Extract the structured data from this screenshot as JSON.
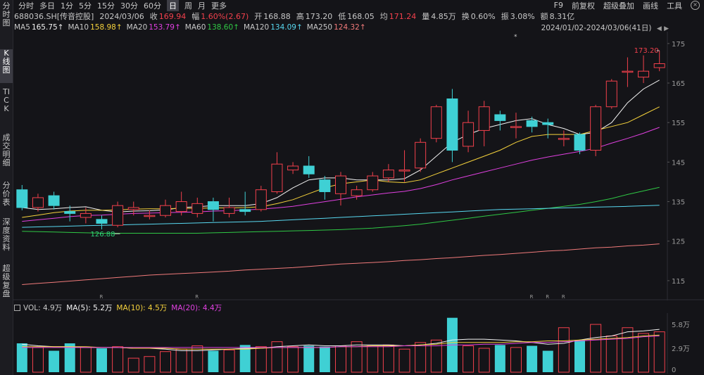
{
  "sidebar": {
    "tabs": [
      {
        "label": "分时图",
        "active": false
      },
      {
        "label": "K线图",
        "active": true
      },
      {
        "label": "TICK",
        "active": false
      },
      {
        "label": "成交明细",
        "active": false
      },
      {
        "label": "分价表",
        "active": false
      },
      {
        "label": "深度资料",
        "active": false
      },
      {
        "label": "超级复盘",
        "active": false
      }
    ]
  },
  "toolbar": {
    "periods": [
      {
        "label": "分时",
        "active": false
      },
      {
        "label": "多日",
        "active": false
      },
      {
        "label": "1分",
        "active": false
      },
      {
        "label": "5分",
        "active": false
      },
      {
        "label": "15分",
        "active": false
      },
      {
        "label": "30分",
        "active": false
      },
      {
        "label": "60分",
        "active": false
      },
      {
        "label": "日",
        "active": true
      },
      {
        "label": "周",
        "active": false
      },
      {
        "label": "月",
        "active": false
      },
      {
        "label": "更多",
        "active": false
      }
    ],
    "right_links": [
      "F9",
      "前复权",
      "超级叠加",
      "画线",
      "工具"
    ]
  },
  "quote": {
    "code_name": "688036.SH[传音控股]",
    "date": "2024/03/06",
    "close_label": "收",
    "close": "169.94",
    "change_label": "幅",
    "change": "1.60%(2.67)",
    "open_label": "开",
    "open": "168.88",
    "high_label": "高",
    "high": "173.20",
    "low_label": "低",
    "low": "168.05",
    "avg_label": "均",
    "avg": "171.24",
    "volume_label": "量",
    "volume": "4.85万",
    "turnover_label": "换",
    "turnover": "0.60%",
    "amplitude_label": "振",
    "amplitude": "3.08%",
    "amount_label": "额",
    "amount": "8.31亿"
  },
  "ma_legend": [
    {
      "label": "MA5",
      "value": "165.75↑",
      "color": "#f2f2f2"
    },
    {
      "label": "MA10",
      "value": "158.98↑",
      "color": "#f5d23c"
    },
    {
      "label": "MA20",
      "value": "153.79↑",
      "color": "#e040e0"
    },
    {
      "label": "MA60",
      "value": "138.60↑",
      "color": "#2fc845"
    },
    {
      "label": "MA120",
      "value": "134.09↑",
      "color": "#58d8f0"
    },
    {
      "label": "MA250",
      "value": "124.32↑",
      "color": "#f07a7a"
    }
  ],
  "date_range": "2024/01/02-2024/03/06(41日)",
  "vol_legend": {
    "vol": "VOL: 4.9万",
    "ma5": "MA(5): 5.2万",
    "ma10": "MA(10): 4.5万",
    "ma20": "MA(20): 4.4万"
  },
  "price_axis_ticks": [
    "175",
    "165",
    "155",
    "145",
    "135",
    "125",
    "115"
  ],
  "vol_axis_ticks": [
    "5.8万",
    "2.9万",
    "0"
  ],
  "annotations": {
    "high_label": "173.20",
    "low_label": "126.88",
    "restoration_marker": "R",
    "star_marker": "*"
  },
  "colors": {
    "up": "#f2404c",
    "down": "#3fd0d4",
    "background": "#141418"
  },
  "chart_data": {
    "type": "candlestick",
    "ylim": [
      110,
      178
    ],
    "candles": [
      {
        "o": 138.0,
        "c": 133.5,
        "h": 139.2,
        "l": 132.8,
        "v": 3.5
      },
      {
        "o": 133.5,
        "c": 136.0,
        "h": 137.0,
        "l": 132.5,
        "v": 3.0
      },
      {
        "o": 136.5,
        "c": 134.0,
        "h": 137.5,
        "l": 133.0,
        "v": 2.6
      },
      {
        "o": 132.5,
        "c": 132.0,
        "h": 134.0,
        "l": 130.0,
        "v": 3.5
      },
      {
        "o": 131.0,
        "c": 132.0,
        "h": 133.5,
        "l": 129.5,
        "v": 3.0
      },
      {
        "o": 130.5,
        "c": 129.5,
        "h": 131.5,
        "l": 128.0,
        "v": 2.9
      },
      {
        "o": 129.0,
        "c": 134.0,
        "h": 135.0,
        "l": 128.5,
        "v": 3.1
      },
      {
        "o": 133.0,
        "c": 133.5,
        "h": 135.0,
        "l": 131.5,
        "v": 1.7
      },
      {
        "o": 131.5,
        "c": 131.5,
        "h": 132.8,
        "l": 130.5,
        "v": 1.9
      },
      {
        "o": 131.5,
        "c": 134.0,
        "h": 135.5,
        "l": 131.0,
        "v": 2.5
      },
      {
        "o": 132.5,
        "c": 135.0,
        "h": 137.5,
        "l": 131.5,
        "v": 2.8
      },
      {
        "o": 132.0,
        "c": 134.5,
        "h": 136.0,
        "l": 131.0,
        "v": 3.2
      },
      {
        "o": 135.0,
        "c": 133.0,
        "h": 136.0,
        "l": 130.0,
        "v": 2.6
      },
      {
        "o": 132.0,
        "c": 133.5,
        "h": 136.0,
        "l": 131.0,
        "v": 2.7
      },
      {
        "o": 133.0,
        "c": 132.5,
        "h": 137.5,
        "l": 131.5,
        "v": 3.3
      },
      {
        "o": 133.0,
        "c": 138.0,
        "h": 139.0,
        "l": 132.5,
        "v": 3.1
      },
      {
        "o": 137.5,
        "c": 144.5,
        "h": 147.5,
        "l": 137.0,
        "v": 3.7
      },
      {
        "o": 143.0,
        "c": 144.0,
        "h": 145.0,
        "l": 142.0,
        "v": 3.1
      },
      {
        "o": 144.0,
        "c": 142.0,
        "h": 146.5,
        "l": 141.0,
        "v": 3.2
      },
      {
        "o": 140.5,
        "c": 137.5,
        "h": 141.5,
        "l": 135.5,
        "v": 3.1
      },
      {
        "o": 137.0,
        "c": 141.5,
        "h": 142.5,
        "l": 134.0,
        "v": 3.2
      },
      {
        "o": 136.5,
        "c": 138.0,
        "h": 139.0,
        "l": 135.5,
        "v": 3.7
      },
      {
        "o": 138.0,
        "c": 141.5,
        "h": 142.5,
        "l": 137.5,
        "v": 3.2
      },
      {
        "o": 141.0,
        "c": 143.0,
        "h": 144.5,
        "l": 140.0,
        "v": 3.3
      },
      {
        "o": 143.0,
        "c": 143.0,
        "h": 148.0,
        "l": 140.0,
        "v": 2.8
      },
      {
        "o": 143.5,
        "c": 150.0,
        "h": 151.0,
        "l": 142.5,
        "v": 3.6
      },
      {
        "o": 151.0,
        "c": 159.0,
        "h": 159.5,
        "l": 150.0,
        "v": 3.9
      },
      {
        "o": 161.0,
        "c": 148.0,
        "h": 163.5,
        "l": 145.0,
        "v": 6.6
      },
      {
        "o": 149.0,
        "c": 155.0,
        "h": 158.0,
        "l": 147.5,
        "v": 3.2
      },
      {
        "o": 153.0,
        "c": 159.0,
        "h": 160.5,
        "l": 149.0,
        "v": 2.9
      },
      {
        "o": 157.0,
        "c": 155.5,
        "h": 158.0,
        "l": 153.0,
        "v": 3.3
      },
      {
        "o": 154.0,
        "c": 154.0,
        "h": 157.5,
        "l": 151.0,
        "v": 3.0
      },
      {
        "o": 155.5,
        "c": 154.0,
        "h": 156.5,
        "l": 152.5,
        "v": 3.2
      },
      {
        "o": 155.0,
        "c": 154.5,
        "h": 156.0,
        "l": 151.0,
        "v": 2.6
      },
      {
        "o": 151.0,
        "c": 151.0,
        "h": 153.0,
        "l": 149.0,
        "v": 5.4
      },
      {
        "o": 152.0,
        "c": 148.0,
        "h": 152.5,
        "l": 147.0,
        "v": 3.9
      },
      {
        "o": 148.0,
        "c": 159.0,
        "h": 159.5,
        "l": 146.5,
        "v": 5.8
      },
      {
        "o": 159.0,
        "c": 165.5,
        "h": 166.0,
        "l": 158.5,
        "v": 4.4
      },
      {
        "o": 168.0,
        "c": 168.0,
        "h": 171.5,
        "l": 164.0,
        "v": 5.4
      },
      {
        "o": 166.5,
        "c": 168.0,
        "h": 172.0,
        "l": 165.0,
        "v": 4.7
      },
      {
        "o": 168.9,
        "c": 169.9,
        "h": 173.2,
        "l": 168.0,
        "v": 4.9
      }
    ],
    "moving_averages": [
      {
        "name": "MA5",
        "color": "#f2f2f2",
        "values": [
          133.5,
          133.0,
          133.2,
          133.5,
          133.7,
          132.8,
          132.4,
          132.6,
          132.7,
          132.9,
          133.5,
          133.7,
          134.0,
          134.0,
          134.0,
          134.5,
          136.0,
          138.5,
          140.5,
          141.0,
          141.0,
          140.5,
          140.5,
          140.5,
          140.8,
          143.0,
          146.5,
          150.0,
          152.0,
          153.5,
          154.5,
          155.5,
          156.0,
          154.5,
          153.5,
          152.0,
          152.5,
          155.0,
          160.0,
          163.5,
          165.75
        ]
      },
      {
        "name": "MA10",
        "color": "#f5d23c",
        "values": [
          131.0,
          131.6,
          132.2,
          132.6,
          132.8,
          132.8,
          132.9,
          133.1,
          133.2,
          133.2,
          133.3,
          133.3,
          133.4,
          133.4,
          133.5,
          133.7,
          134.5,
          135.5,
          137.0,
          138.5,
          139.5,
          140.0,
          140.5,
          140.0,
          139.8,
          140.5,
          142.0,
          143.5,
          145.0,
          146.5,
          148.0,
          150.0,
          151.5,
          152.0,
          152.0,
          152.0,
          153.0,
          154.0,
          155.0,
          157.0,
          158.98
        ]
      },
      {
        "name": "MA20",
        "color": "#e040e0",
        "values": [
          130.0,
          130.4,
          130.8,
          131.2,
          131.5,
          131.6,
          131.8,
          132.0,
          132.1,
          132.2,
          132.3,
          132.4,
          132.6,
          132.7,
          132.9,
          133.1,
          133.4,
          133.8,
          134.4,
          135.0,
          135.6,
          136.2,
          136.7,
          137.2,
          137.6,
          138.3,
          139.3,
          140.5,
          141.5,
          142.5,
          143.5,
          144.5,
          145.5,
          146.3,
          147.0,
          147.7,
          148.5,
          149.8,
          151.0,
          152.3,
          153.79
        ]
      },
      {
        "name": "MA60",
        "color": "#2fc845",
        "values": [
          127.5,
          127.4,
          127.3,
          127.2,
          127.1,
          127.0,
          127.0,
          127.0,
          127.0,
          127.0,
          127.0,
          127.0,
          127.1,
          127.2,
          127.3,
          127.4,
          127.5,
          127.6,
          127.7,
          127.8,
          127.9,
          128.1,
          128.3,
          128.6,
          128.9,
          129.3,
          129.8,
          130.3,
          130.8,
          131.3,
          131.8,
          132.3,
          132.8,
          133.3,
          133.8,
          134.3,
          135.0,
          135.8,
          136.8,
          137.7,
          138.6
        ]
      },
      {
        "name": "MA120",
        "color": "#58d8f0",
        "values": [
          128.5,
          128.6,
          128.7,
          128.8,
          128.9,
          129.0,
          129.1,
          129.2,
          129.3,
          129.4,
          129.5,
          129.6,
          129.7,
          129.8,
          129.9,
          130.0,
          130.2,
          130.4,
          130.6,
          130.8,
          131.0,
          131.2,
          131.4,
          131.6,
          131.8,
          132.0,
          132.2,
          132.4,
          132.6,
          132.8,
          133.0,
          133.1,
          133.2,
          133.3,
          133.4,
          133.5,
          133.6,
          133.7,
          133.8,
          133.95,
          134.09
        ]
      },
      {
        "name": "MA250",
        "color": "#f07a7a",
        "values": [
          114.0,
          114.3,
          114.6,
          114.9,
          115.2,
          115.5,
          115.8,
          116.1,
          116.4,
          116.6,
          116.8,
          117.0,
          117.2,
          117.4,
          117.7,
          117.9,
          118.1,
          118.3,
          118.6,
          118.9,
          119.2,
          119.4,
          119.6,
          119.8,
          120.1,
          120.3,
          120.6,
          120.8,
          121.1,
          121.4,
          121.6,
          121.9,
          122.2,
          122.5,
          122.7,
          123.0,
          123.3,
          123.5,
          123.8,
          124.0,
          124.32
        ]
      }
    ],
    "volume_ma": [
      {
        "name": "MA(5)",
        "color": "#f2f2f2",
        "values": [
          3.4,
          3.2,
          3.1,
          3.1,
          3.0,
          3.0,
          3.0,
          2.9,
          2.9,
          2.8,
          2.6,
          2.6,
          2.7,
          2.8,
          2.9,
          2.9,
          3.1,
          3.2,
          3.3,
          3.2,
          3.2,
          3.3,
          3.3,
          3.3,
          3.2,
          3.3,
          3.5,
          3.9,
          4.0,
          4.0,
          3.9,
          3.8,
          3.6,
          3.4,
          3.5,
          3.9,
          4.2,
          4.4,
          4.9,
          5.0,
          5.2
        ]
      },
      {
        "name": "MA(10)",
        "color": "#f5d23c",
        "values": [
          3.1,
          3.1,
          3.1,
          3.1,
          3.1,
          3.0,
          3.0,
          2.9,
          2.9,
          2.9,
          2.8,
          2.8,
          2.8,
          2.8,
          2.8,
          2.9,
          3.0,
          3.0,
          3.0,
          3.0,
          3.1,
          3.1,
          3.2,
          3.2,
          3.2,
          3.3,
          3.4,
          3.6,
          3.6,
          3.6,
          3.6,
          3.7,
          3.7,
          3.8,
          3.8,
          3.9,
          4.0,
          4.1,
          4.2,
          4.4,
          4.5
        ]
      },
      {
        "name": "MA(20)",
        "color": "#e040e0",
        "values": [
          3.0,
          3.0,
          3.0,
          3.0,
          3.0,
          3.0,
          3.0,
          3.0,
          3.0,
          3.0,
          3.0,
          3.0,
          3.0,
          3.0,
          3.0,
          3.0,
          3.0,
          3.0,
          3.0,
          3.0,
          3.1,
          3.1,
          3.1,
          3.1,
          3.2,
          3.2,
          3.2,
          3.3,
          3.3,
          3.4,
          3.4,
          3.5,
          3.6,
          3.6,
          3.7,
          3.8,
          3.9,
          4.0,
          4.1,
          4.3,
          4.4
        ]
      }
    ],
    "vol_ylim": [
      0,
      7.0
    ],
    "restoration_marks_at": [
      5,
      11,
      32,
      33,
      34
    ]
  }
}
